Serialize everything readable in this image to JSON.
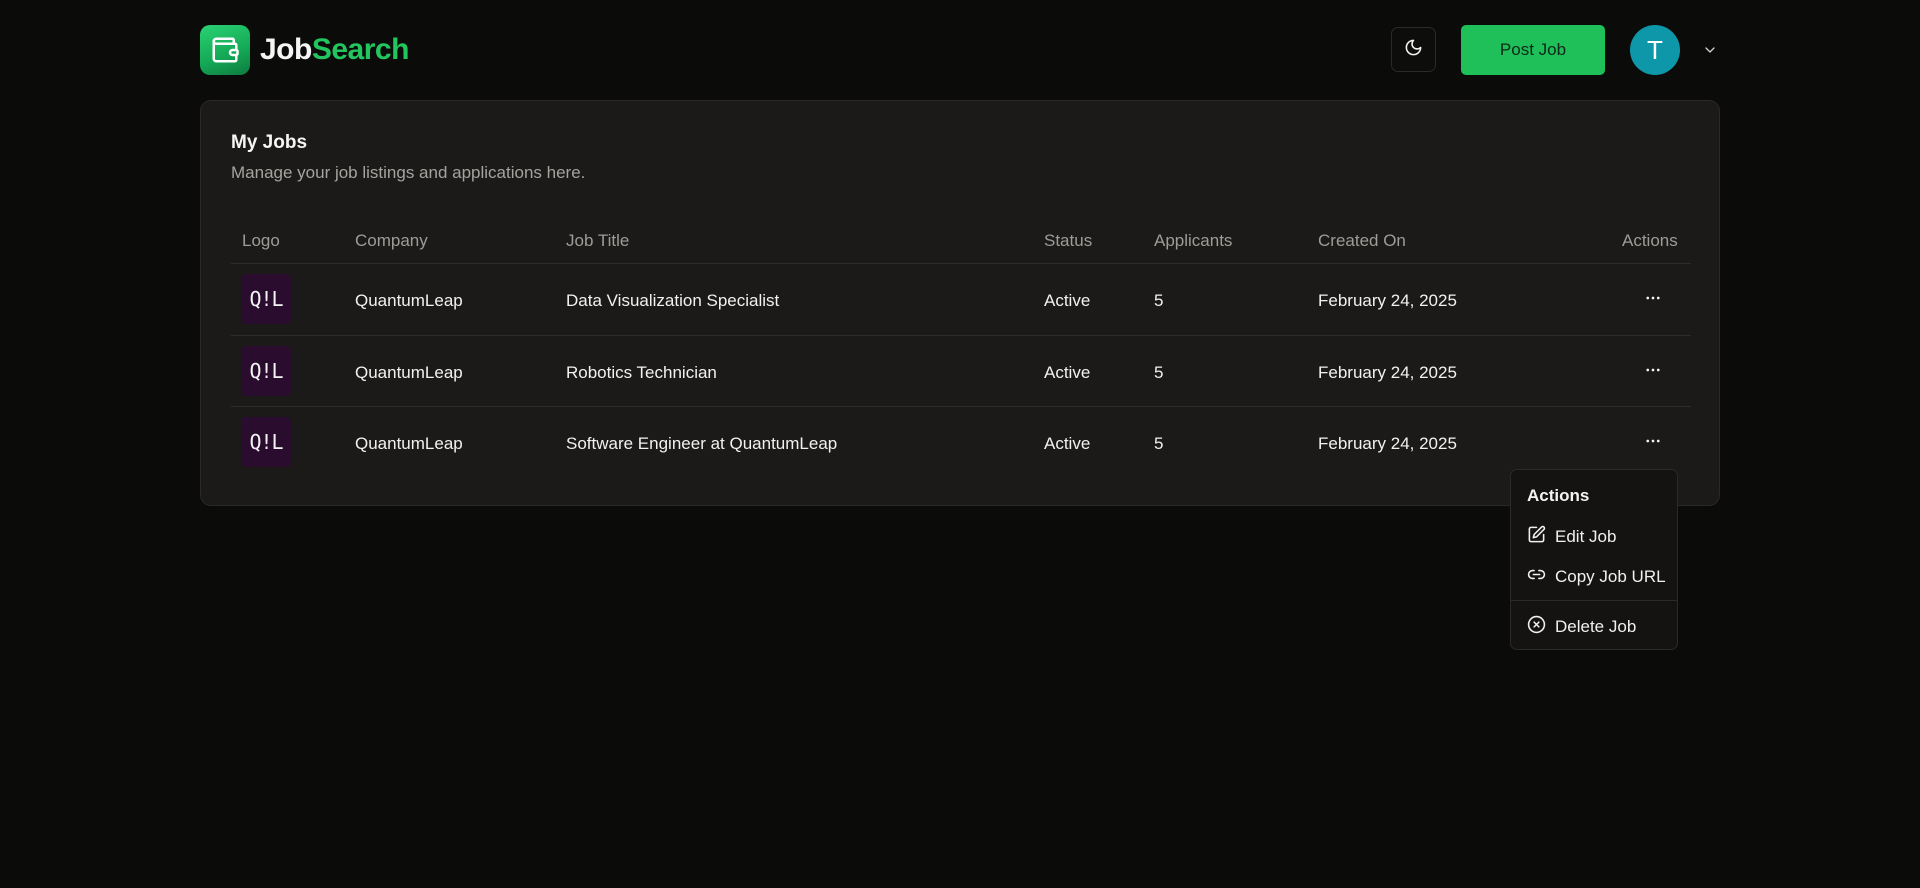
{
  "brand": {
    "part1": "Job",
    "part2": "Search"
  },
  "header": {
    "post_job_label": "Post Job",
    "avatar_initial": "T"
  },
  "card": {
    "title": "My Jobs",
    "subtitle": "Manage your job listings and applications here."
  },
  "table": {
    "columns": {
      "logo": "Logo",
      "company": "Company",
      "job_title": "Job Title",
      "status": "Status",
      "applicants": "Applicants",
      "created_on": "Created On",
      "actions": "Actions"
    },
    "rows": [
      {
        "logo_text": "Q!L",
        "company": "QuantumLeap",
        "job_title": "Data Visualization Specialist",
        "status": "Active",
        "applicants": "5",
        "created_on": "February 24, 2025"
      },
      {
        "logo_text": "Q!L",
        "company": "QuantumLeap",
        "job_title": "Robotics Technician",
        "status": "Active",
        "applicants": "5",
        "created_on": "February 24, 2025"
      },
      {
        "logo_text": "Q!L",
        "company": "QuantumLeap",
        "job_title": "Software Engineer at QuantumLeap",
        "status": "Active",
        "applicants": "5",
        "created_on": "February 24, 2025"
      }
    ]
  },
  "menu": {
    "label": "Actions",
    "edit": "Edit Job",
    "copy": "Copy Job URL",
    "delete": "Delete Job"
  },
  "icons": {
    "logo": "wallet-icon",
    "theme": "moon-icon",
    "chevron": "chevron-down-icon",
    "row_actions": "more-horizontal-icon",
    "edit": "edit-icon",
    "copy": "link-icon",
    "delete": "x-circle-icon"
  },
  "colors": {
    "accent": "#22c55e",
    "background": "#0b0b0a",
    "card": "#1c1a18",
    "avatar": "#0e97a8"
  }
}
